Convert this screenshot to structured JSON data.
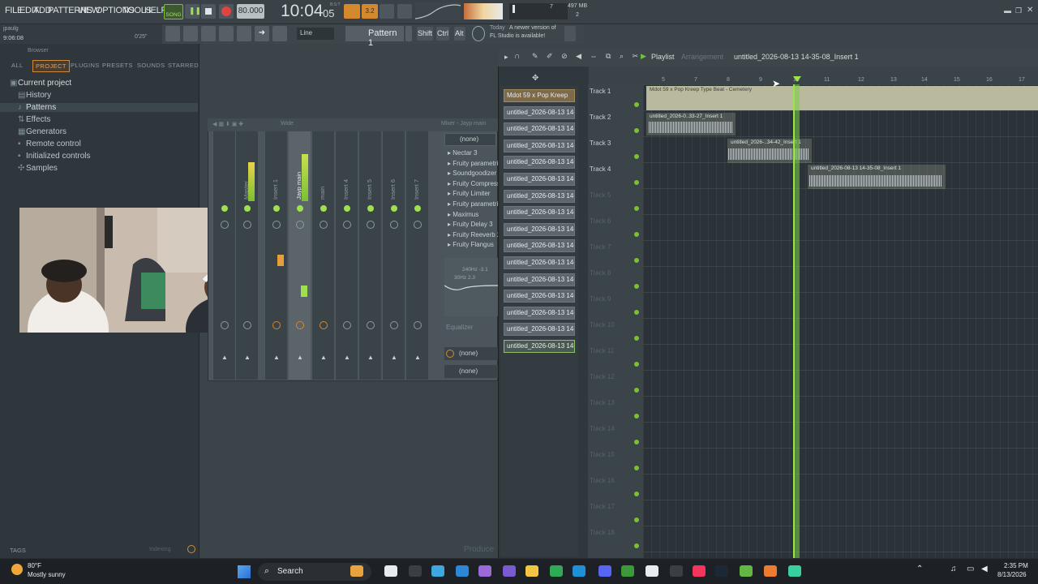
{
  "menu": {
    "items": [
      "FILE",
      "EDIT",
      "ADD",
      "PATTERNS",
      "VIEW",
      "OPTIONS",
      "TOOLS",
      "HELP"
    ]
  },
  "transport": {
    "mode": "SONG",
    "tempo": "80.000",
    "time": "10:04",
    "time_sub": "05",
    "time_tag": "B:S:T",
    "cpu_polyphony": "7",
    "memory": "497 MB",
    "cpu2": "2"
  },
  "info": {
    "user": "jpaulg",
    "elapsed": "9:06:08",
    "duration": "0'25\""
  },
  "toolbar": {
    "snap": "Line",
    "pattern": "Pattern 1",
    "shift": "Shift",
    "ctrl": "Ctrl",
    "alt": "Alt",
    "news_date": "Today",
    "news_text": "A newer version of",
    "news_text2": "FL Studio is available!"
  },
  "browser": {
    "title": "Browser",
    "tabs": [
      "ALL",
      "PROJECT",
      "PLUGINS",
      "PRESETS",
      "SOUNDS",
      "STARRED"
    ],
    "active_tab": "PROJECT",
    "items": [
      "Current project",
      "History",
      "Patterns",
      "Effects",
      "Generators",
      "Remote control",
      "Initialized controls",
      "Samples"
    ],
    "tags": "TAGS",
    "indexing": "Indexing"
  },
  "mixer": {
    "title": "Mixer - Jayp main",
    "wide": "Wide",
    "channels": [
      "Master",
      "Insert 1",
      "Jayp main",
      "main",
      "Insert 4",
      "Insert 5",
      "Insert 6",
      "Insert 7"
    ],
    "slot_none": "(none)",
    "fx": [
      "Nectar 3",
      "Fruity parametric",
      "Soundgoodizer",
      "Fruity Compressor",
      "Fruity Limiter",
      "Fruity parametric",
      "Maximus",
      "Fruity Delay 3",
      "Fruity Reeverb 2",
      "Fruity Flangus"
    ],
    "eq_label": "Equalizer",
    "eq_readout": "240Hz -3.1",
    "eq_readout2": "30Hz 2.3",
    "bottom_slots": [
      "(none)",
      "(none)"
    ]
  },
  "playlist": {
    "title": "Playlist",
    "subtitle": "Arrangement",
    "file": "untitled_2026-08-13 14-35-08_Insert 1",
    "ruler": [
      "5",
      "7",
      "8",
      "9",
      "10",
      "11",
      "12",
      "13",
      "14",
      "15",
      "16",
      "17"
    ],
    "tracks": [
      "Track 1",
      "Track 2",
      "Track 3",
      "Track 4",
      "Track 5",
      "Track 6",
      "Track 7",
      "Track 8",
      "Track 9",
      "Track 10",
      "Track 11",
      "Track 12",
      "Track 13",
      "Track 14",
      "Track 15",
      "Track 16",
      "Track 17",
      "Track 18"
    ],
    "clips": {
      "beat": "Mdot 59 x Pop Kreep Type Beat - Cemetery",
      "c1": "untitled_2026-0..33-27_Insert 1",
      "c2": "untitled_2026-..34-42_Insert 1",
      "c3": "untitled_2026-08-13 14-35-08_Insert 1"
    }
  },
  "patterns": {
    "items": [
      "Mdot 59 x Pop Kreep",
      "untitled_2026-08-13 14-",
      "untitled_2026-08-13 14-",
      "untitled_2026-08-13 14-",
      "untitled_2026-08-13 14-",
      "untitled_2026-08-13 14-",
      "untitled_2026-08-13 14-",
      "untitled_2026-08-13 14-",
      "untitled_2026-08-13 14-",
      "untitled_2026-08-13 14-",
      "untitled_2026-08-13 14-",
      "untitled_2026-08-13 14-",
      "untitled_2026-08-13 14-",
      "untitled_2026-08-13 14-",
      "untitled_2026-08-13 14-",
      "untitled_2026-08-13 14-"
    ],
    "hint": "Produce"
  },
  "taskbar": {
    "weather_temp": "80°F",
    "weather_text": "Mostly sunny",
    "search": "Search",
    "clock": "2:35 PM",
    "date": "8/13/2026"
  }
}
